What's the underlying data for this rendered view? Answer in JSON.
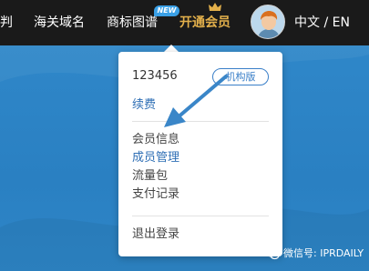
{
  "nav": {
    "partial_item": "判",
    "customs_domain": "海关域名",
    "trademark_graph": "商标图谱",
    "new_badge": "NEW",
    "open_membership": "开通会员",
    "language": "中文 / EN"
  },
  "dropdown": {
    "user_id": "123456",
    "account_type": "机构版",
    "renew": "续费",
    "items": [
      {
        "label": "会员信息"
      },
      {
        "label": "成员管理"
      },
      {
        "label": "流量包"
      },
      {
        "label": "支付记录"
      }
    ],
    "logout": "退出登录"
  },
  "watermark": {
    "text": "微信号: IPRDAILY"
  },
  "colors": {
    "topbar": "#1a1a1a",
    "background_blue": "#2b82c4",
    "vip_gold": "#e3b04b",
    "link_blue": "#2f6fb5",
    "arrow_blue": "#3a86c8"
  }
}
